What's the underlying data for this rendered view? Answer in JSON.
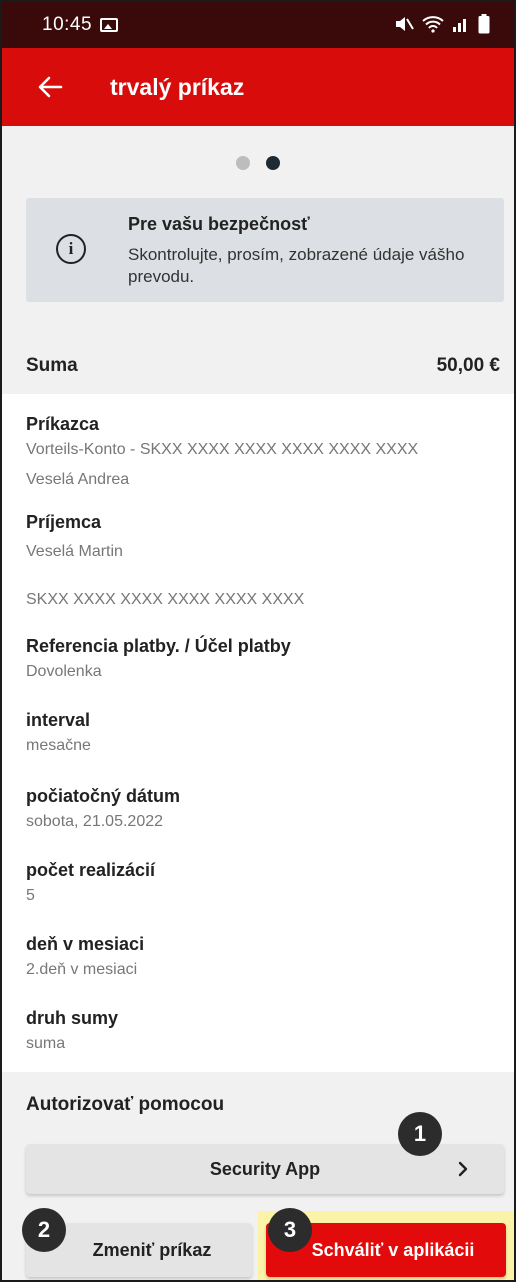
{
  "status_bar": {
    "time": "10:45",
    "icons": [
      "image-icon",
      "mute-icon",
      "wifi-icon",
      "signal-icon",
      "battery-icon"
    ]
  },
  "app_bar": {
    "title": "trvalý príkaz",
    "back_icon": "arrow-left-icon"
  },
  "pager": {
    "count": 2,
    "active_index": 1
  },
  "notice": {
    "title": "Pre vašu bezpečnosť",
    "text": "Skontrolujte, prosím, zobrazené údaje vášho prevodu.",
    "icon": "info-icon"
  },
  "sum": {
    "label": "Suma",
    "value": "50,00 €"
  },
  "details": {
    "payer_label": "Príkazca",
    "payer_account": "Vorteils-Konto - SKXX XXXX XXXX XXXX XXXX XXXX",
    "payer_name": "Veselá Andrea",
    "payee_label": "Príjemca",
    "payee_name": "Veselá Martin",
    "payee_account": "SKXX XXXX XXXX XXXX XXXX XXXX",
    "reference_label": "Referencia platby. / Účel platby",
    "reference_value": "Dovolenka",
    "interval_label": "interval",
    "interval_value": "mesačne",
    "start_label": "počiatočný dátum",
    "start_value": "sobota, 21.05.2022",
    "count_label": "počet realizácií",
    "count_value": "5",
    "day_label": "deň v mesiaci",
    "day_value": "2.deň v mesiaci",
    "amount_type_label": "druh sumy",
    "amount_type_value": "suma"
  },
  "auth": {
    "title": "Autorizovať pomocou",
    "method_label": "Security App",
    "change_label": "Zmeniť príkaz",
    "approve_label": "Schváliť v aplikácii"
  },
  "markers": [
    "1",
    "2",
    "3"
  ],
  "colors": {
    "accent_red": "#d90c0c",
    "status_bar": "#3a0a0a",
    "highlight": "#fbf4a8"
  }
}
